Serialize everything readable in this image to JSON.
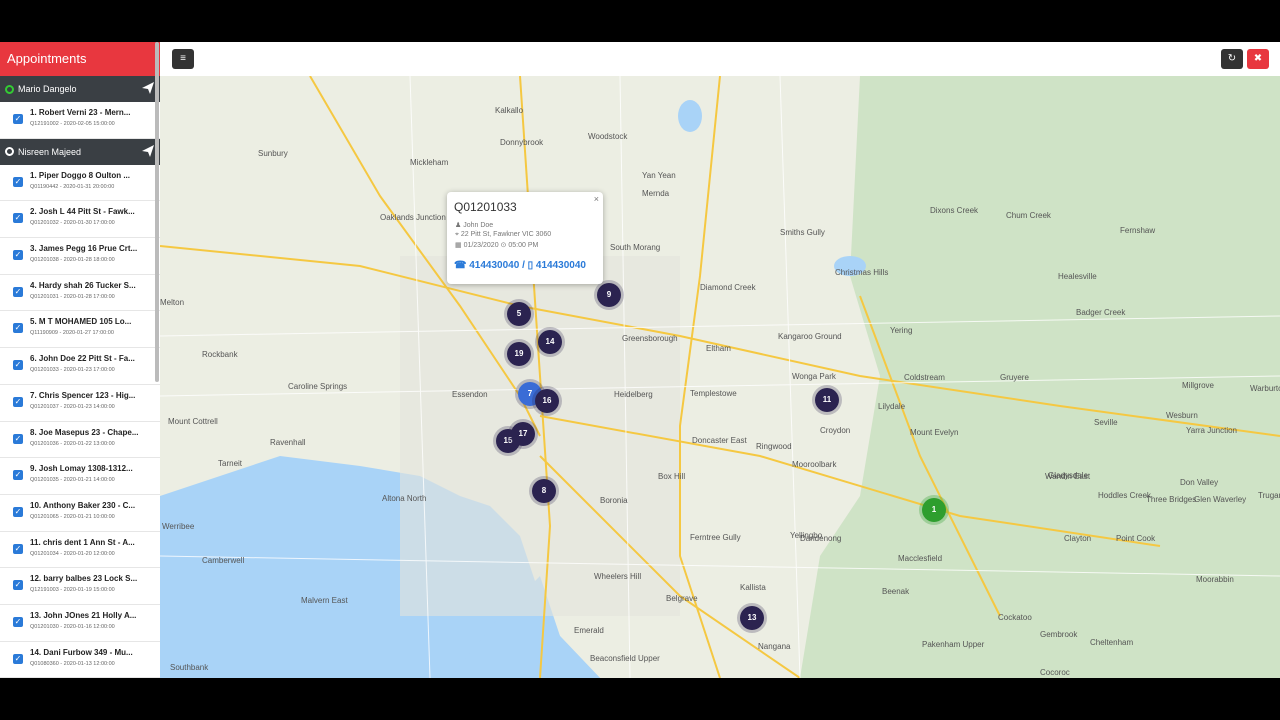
{
  "sidebar": {
    "title": "Appointments",
    "groups": [
      {
        "name": "Mario Dangelo"
      },
      {
        "name": "Nisreen Majeed"
      }
    ],
    "items": [
      {
        "title": "1. Robert Verni 23 - Mern...",
        "sub": "Q12191002 - 2020-02-05 15:00:00"
      },
      {
        "title": "1. Piper Doggo 8 Oulton ...",
        "sub": "Q01190442 - 2020-01-31 20:00:00"
      },
      {
        "title": "2. Josh L 44 Pitt St - Fawk...",
        "sub": "Q01201032 - 2020-01-30 17:00:00"
      },
      {
        "title": "3. James Pegg 16 Prue Crt...",
        "sub": "Q01201038 - 2020-01-28 18:00:00"
      },
      {
        "title": "4. Hardy shah 26 Tucker S...",
        "sub": "Q01201031 - 2020-01-28 17:00:00"
      },
      {
        "title": "5. M T MOHAMED 105 Lo...",
        "sub": "Q11190909 - 2020-01-27 17:00:00"
      },
      {
        "title": "6. John Doe 22 Pitt St - Fa...",
        "sub": "Q01201033 - 2020-01-23 17:00:00"
      },
      {
        "title": "7. Chris Spencer 123 - Hig...",
        "sub": "Q01201037 - 2020-01-23 14:00:00"
      },
      {
        "title": "8. Joe Masepus 23 - Chape...",
        "sub": "Q01201036 - 2020-01-22 13:00:00"
      },
      {
        "title": "9. Josh Lomay 1308-1312...",
        "sub": "Q01201035 - 2020-01-21 14:00:00"
      },
      {
        "title": "10. Anthony Baker 230 - C...",
        "sub": "Q01201065 - 2020-01-21 10:00:00"
      },
      {
        "title": "11. chris dent 1 Ann St - A...",
        "sub": "Q01201034 - 2020-01-20 12:00:00"
      },
      {
        "title": "12. barry balbes 23 Lock S...",
        "sub": "Q12191003 - 2020-01-19 15:00:00"
      },
      {
        "title": "13. John JOnes 21 Holly A...",
        "sub": "Q01201030 - 2020-01-16 12:00:00"
      },
      {
        "title": "14. Dani Furbow 349 - Mu...",
        "sub": "Q01080360 - 2020-01-13 12:00:00"
      }
    ]
  },
  "popup": {
    "quote": "Q01201033",
    "name": "John Doe",
    "address": "22 Pitt St, Fawkner VIC 3060",
    "datetime": "01/23/2020 ⊙ 05:00 PM",
    "phones": "☎ 414430040 / ▯ 414430040",
    "close": "×"
  },
  "clusters": [
    "9",
    "5",
    "19",
    "14",
    "7",
    "16",
    "15",
    "17",
    "8",
    "11",
    "1",
    "13"
  ],
  "places": [
    "Sunbury",
    "Kalkallo",
    "Donnybrook",
    "Woodstock",
    "Mickleham",
    "Yan Yean",
    "Craigieburn",
    "Mernda",
    "Oaklands Junction",
    "Bulla",
    "South Morang",
    "Smiths Gully",
    "Dixons Creek",
    "Chum Creek",
    "Fernshaw",
    "Diamond Creek",
    "Christmas Hills",
    "Healesville",
    "Badger Creek",
    "Melton",
    "Greensborough",
    "Eltham",
    "Kangaroo Ground",
    "Yering",
    "Rockbank",
    "Caroline Springs",
    "Essendon",
    "Heidelberg",
    "Templestowe",
    "Wonga Park",
    "Coldstream",
    "Gruyere",
    "Millgrove",
    "Warburton",
    "Mount Cottrell",
    "Ravenhall",
    "Doncaster East",
    "Ringwood",
    "Lilydale",
    "Mount Evelyn",
    "Wesburn",
    "Croydon",
    "Seville",
    "Yarra Junction",
    "Tarneit",
    "Altona North",
    "Box Hill",
    "Mooroolbark",
    "Wandin East",
    "Don Valley",
    "Hoddles Creek",
    "Truganina",
    "Werribee",
    "Camberwell",
    "Boronia",
    "Yellingbo",
    "Gladysdale",
    "Three Bridges",
    "Glen Waverley",
    "Ferntree Gully",
    "Dandenong",
    "Nangana",
    "Point Cook",
    "Malvern East",
    "Wheelers Hill",
    "Kallista",
    "Macclesfield",
    "Clayton",
    "Belgrave",
    "Beenak",
    "Moorabbin",
    "Emerald",
    "Cockatoo",
    "Gembrook",
    "Cheltenham",
    "Beaconsfield Upper",
    "Pakenham Upper",
    "Cocoroc",
    "Southbank"
  ],
  "colors": {
    "accent": "#e8373f",
    "cluster": "#2b2350",
    "green": "#2e9e2e",
    "link": "#2a7ad8"
  },
  "icons": {
    "menu": "menu-icon",
    "refresh": "refresh-icon",
    "close": "close-icon",
    "send": "paper-plane-icon"
  }
}
